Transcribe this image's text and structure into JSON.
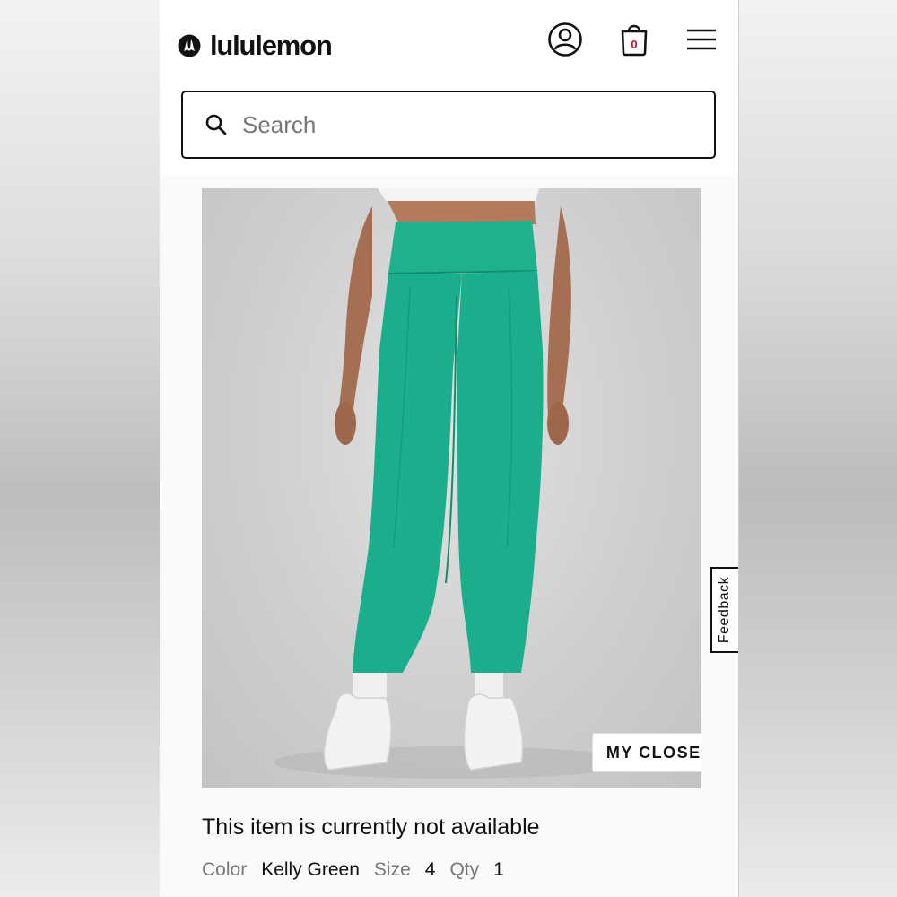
{
  "brand": {
    "name": "lululemon"
  },
  "header": {
    "account_icon": "account-circle-icon",
    "bag_icon": "shopping-bag-icon",
    "bag_count": "0",
    "menu_icon": "hamburger-menu-icon"
  },
  "search": {
    "placeholder": "Search",
    "value": ""
  },
  "product": {
    "image_alt": "Kelly Green high-rise leggings",
    "closet_button": "MY CLOSET",
    "availability": "This item is currently not available",
    "color_label": "Color",
    "color_value": "Kelly Green",
    "size_label": "Size",
    "size_value": "4",
    "qty_label": "Qty",
    "qty_value": "1"
  },
  "feedback": {
    "label": "Feedback"
  },
  "colors": {
    "accent": "#c8102e",
    "legging": "#1aae8c",
    "text": "#111111"
  }
}
